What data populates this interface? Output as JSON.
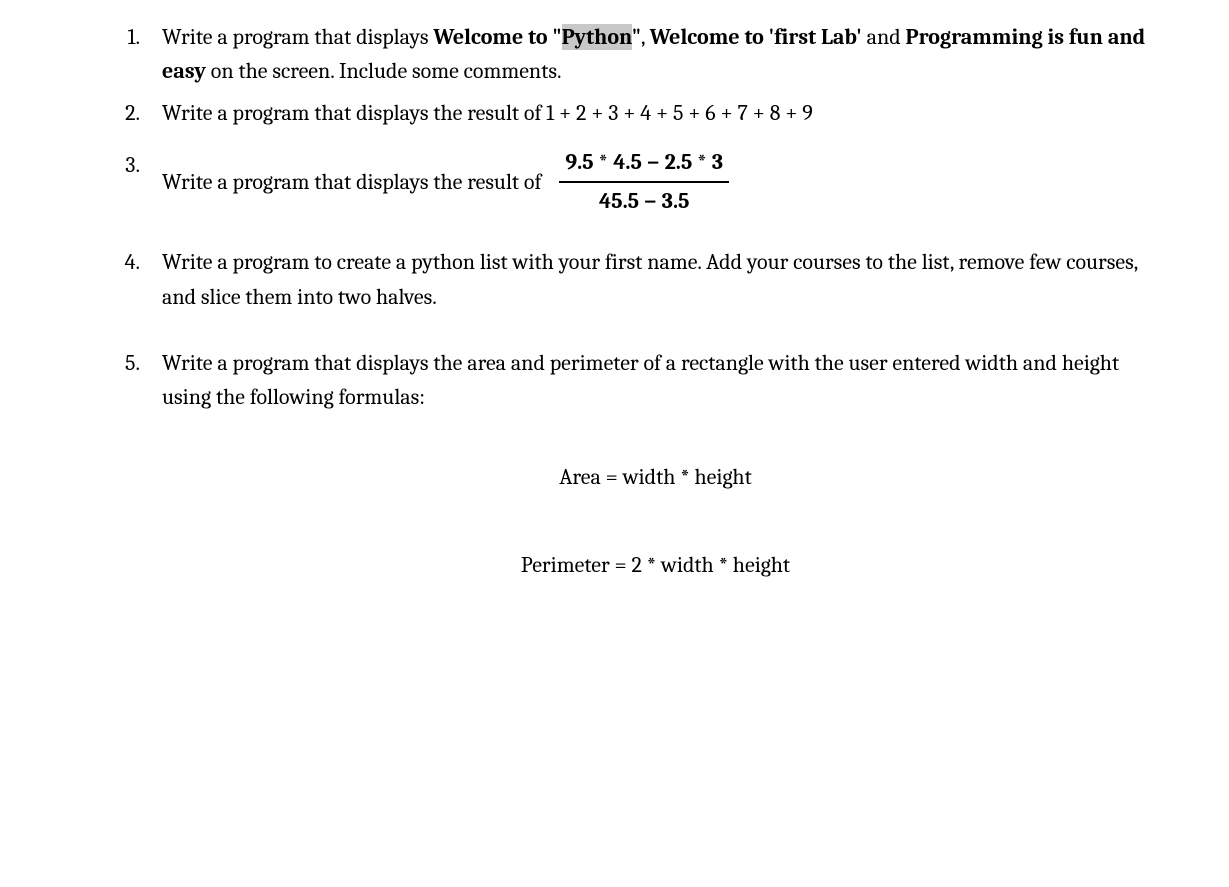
{
  "q1": {
    "t1": "Write a program that displays ",
    "b1": "Welcome to \"",
    "b1_hl": "Python",
    "b1_end": "\"",
    "sep1": ", ",
    "b2": "Welcome to 'first Lab'",
    "mid": " and ",
    "b3": "Programming is fun and easy",
    "tail": " on the screen. Include some comments."
  },
  "q2": {
    "text": "Write a program that displays the result of 1 + 2 + 3 + 4 + 5 + 6 + 7 + 8 + 9"
  },
  "q3": {
    "text": "Write a program that displays the result of",
    "numerator": "9.5 * 4.5 − 2.5 * 3",
    "denominator": "45.5 − 3.5"
  },
  "q4": {
    "text": "Write a program to create a python list with your first name. Add your courses to the list, remove few courses, and slice them into two halves."
  },
  "q5": {
    "text": "Write a program that displays the area and perimeter of a rectangle with the user entered width and height using the following formulas:",
    "formula1": "Area = width * height",
    "formula2": "Perimeter = 2 * width * height"
  }
}
